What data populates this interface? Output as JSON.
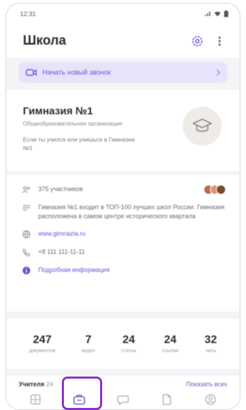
{
  "status_bar": {
    "time": "12:31",
    "signal_icon": "signal-icon",
    "wifi_icon": "wifi-icon",
    "battery_icon": "battery-icon"
  },
  "header": {
    "title": "Школа",
    "settings_icon": "gear-icon",
    "more_icon": "more-vertical-icon"
  },
  "banner": {
    "label": "Начать новый звонок",
    "icon": "video-camera-icon",
    "chevron": "chevron-right-icon"
  },
  "school": {
    "name": "Гимназия №1",
    "type": "Общеобразовательная организация",
    "description": "Если ты учился или учишься в Гимназии №1",
    "avatar_icon": "graduation-cap-icon"
  },
  "info": {
    "participants": "375 участников",
    "about": "Гимназия №1 входит в ТОП-100 лучших школ России. Гимназия расположена в самом центре исторического квартала",
    "website": "www.gimnazia.ru",
    "phone": "+8 111 111-11-11",
    "more_link": "Подробная информация"
  },
  "stats": [
    {
      "value": "247",
      "label": "документов"
    },
    {
      "value": "7",
      "label": "видео"
    },
    {
      "value": "24",
      "label": "статьи"
    },
    {
      "value": "24",
      "label": "ссылки"
    },
    {
      "value": "32",
      "label": "чаты"
    }
  ],
  "teachers": {
    "title": "Учителя",
    "count": "24",
    "show_all": "Показать всех"
  },
  "tabbar": {
    "items": [
      "apps-icon",
      "school-icon",
      "chat-icon",
      "document-icon",
      "profile-icon"
    ],
    "active_index": 1
  },
  "colors": {
    "accent": "#6b55d6",
    "banner_bg": "#e8e3fb",
    "highlight": "#8b2fc9"
  }
}
